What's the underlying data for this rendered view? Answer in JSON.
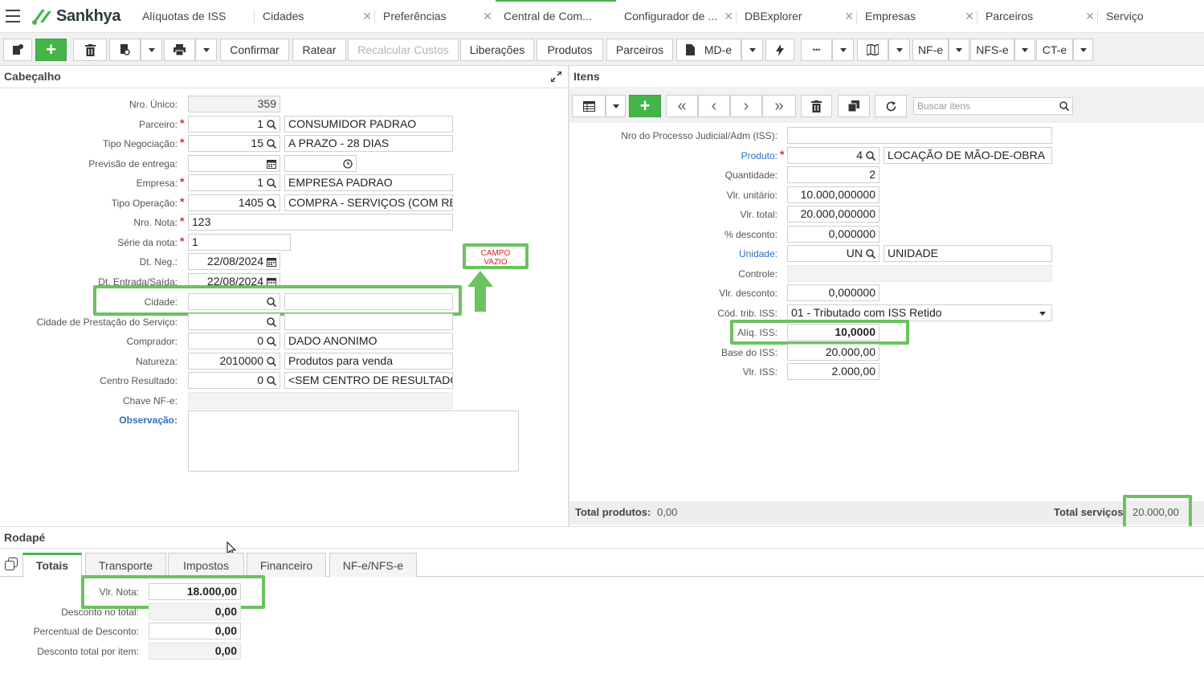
{
  "app": {
    "name": "Sankhya"
  },
  "tabs": [
    {
      "label": "Alíquotas de ISS"
    },
    {
      "label": "Cidades"
    },
    {
      "label": "Preferências"
    },
    {
      "label": "Central de Com..."
    },
    {
      "label": "Configurador de ..."
    },
    {
      "label": "DBExplorer"
    },
    {
      "label": "Empresas"
    },
    {
      "label": "Parceiros"
    },
    {
      "label": "Serviço"
    }
  ],
  "toolbar": {
    "confirmar": "Confirmar",
    "ratear": "Ratear",
    "recalcular": "Recalcular Custos",
    "liberacoes": "Liberações",
    "produtos": "Produtos",
    "parceiros": "Parceiros",
    "mde": "MD-e",
    "more": "•••",
    "nfe": "NF-e",
    "nfse": "NFS-e",
    "cte": "CT-e"
  },
  "header": {
    "title": "Cabeçalho",
    "nro_unico": {
      "label": "Nro. Único:",
      "value": "359"
    },
    "parceiro": {
      "label": "Parceiro:",
      "code": "1",
      "desc": "CONSUMIDOR PADRAO"
    },
    "tipo_negociacao": {
      "label": "Tipo Negociação:",
      "code": "15",
      "desc": "A PRAZO - 28 DIAS"
    },
    "previsao": {
      "label": "Previsão de entrega:"
    },
    "empresa": {
      "label": "Empresa:",
      "code": "1",
      "desc": "EMPRESA PADRAO"
    },
    "tipo_operacao": {
      "label": "Tipo Operação:",
      "code": "1405",
      "desc": "COMPRA - SERVIÇOS (COM RET"
    },
    "nro_nota": {
      "label": "Nro. Nota:",
      "value": "123"
    },
    "serie": {
      "label": "Série da nota:",
      "value": "1"
    },
    "dt_neg": {
      "label": "Dt. Neg.:",
      "value": "22/08/2024"
    },
    "dt_entrada": {
      "label": "Dt. Entrada/Saída:",
      "value": "22/08/2024"
    },
    "cidade": {
      "label": "Cidade:",
      "code": "",
      "desc": ""
    },
    "cidade_prest": {
      "label": "Cidade de Prestação do Serviço:",
      "code": "",
      "desc": ""
    },
    "comprador": {
      "label": "Comprador:",
      "code": "0",
      "desc": "DADO ANONIMO"
    },
    "natureza": {
      "label": "Natureza:",
      "code": "2010000",
      "desc": "Produtos para venda"
    },
    "centro": {
      "label": "Centro Resultado:",
      "code": "0",
      "desc": "<SEM CENTRO DE RESULTADO>"
    },
    "chave": {
      "label": "Chave NF-e:",
      "value": ""
    },
    "observacao": {
      "label": "Observação:",
      "value": ""
    },
    "annotation": "CAMPO VAZIO"
  },
  "items": {
    "title": "Itens",
    "search_placeholder": "Buscar itens",
    "processo": {
      "label": "Nro do Processo Judicial/Adm (ISS):",
      "value": ""
    },
    "produto": {
      "label": "Produto:",
      "code": "4",
      "desc": "LOCAÇÃO DE MÃO-DE-OBRA"
    },
    "quantidade": {
      "label": "Quantidade:",
      "value": "2"
    },
    "vlr_unit": {
      "label": "Vlr. unitário:",
      "value": "10.000,000000"
    },
    "vlr_total": {
      "label": "Vlr. total:",
      "value": "20.000,000000"
    },
    "desconto_pct": {
      "label": "% desconto:",
      "value": "0,000000"
    },
    "unidade": {
      "label": "Unidade:",
      "code": "UN",
      "desc": "UNIDADE"
    },
    "controle": {
      "label": "Controle:",
      "value": ""
    },
    "vlr_desconto": {
      "label": "Vlr. desconto:",
      "value": "0,000000"
    },
    "cod_trib": {
      "label": "Cód. trib. ISS:",
      "value": "01 - Tributado com ISS Retido"
    },
    "aliq_iss": {
      "label": "Alíq. ISS:",
      "value": "10,0000"
    },
    "base_iss": {
      "label": "Base do ISS:",
      "value": "20.000,00"
    },
    "vlr_iss": {
      "label": "Vlr. ISS:",
      "value": "2.000,00"
    },
    "total_produtos_label": "Total produtos:",
    "total_produtos": "0,00",
    "total_servicos_label": "Total serviços",
    "total_servicos": "20.000,00"
  },
  "footer": {
    "title": "Rodapé",
    "tabs": [
      "Totais",
      "Transporte",
      "Impostos",
      "Financeiro",
      "NF-e/NFS-e"
    ],
    "vlr_nota": {
      "label": "Vlr. Nota:",
      "value": "18.000,00"
    },
    "desc_total": {
      "label": "Desconto no total:",
      "value": "0,00"
    },
    "perc_desc": {
      "label": "Percentual de Desconto:",
      "value": "0,00"
    },
    "desc_item": {
      "label": "Desconto total por item:",
      "value": "0,00"
    }
  },
  "colors": {
    "accent": "#46b549",
    "highlight": "#6cc160",
    "required": "#d9322b",
    "link": "#2b72c2"
  }
}
